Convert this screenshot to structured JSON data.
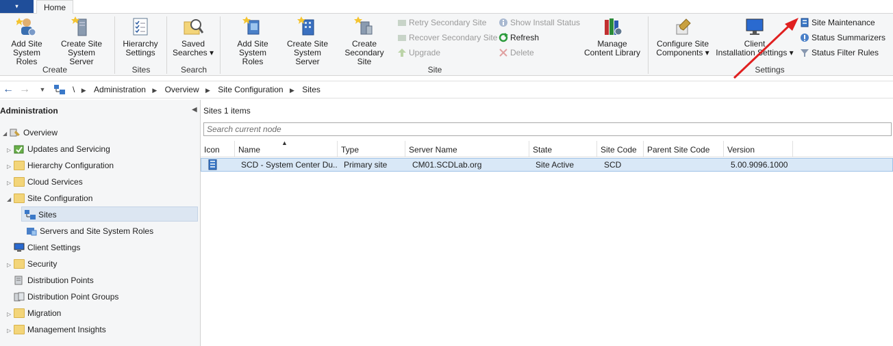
{
  "ribbon": {
    "tab_home": "Home",
    "groups": {
      "create": "Create",
      "sites": "Sites",
      "search": "Search",
      "site": "Site",
      "settings": "Settings"
    },
    "add_site_system_roles": [
      "Add Site",
      "System Roles"
    ],
    "create_site_system_server": [
      "Create Site",
      "System Server"
    ],
    "hierarchy_settings": [
      "Hierarchy",
      "Settings"
    ],
    "saved_searches": [
      "Saved",
      "Searches ▾"
    ],
    "add_site_system_roles_2": [
      "Add Site",
      "System Roles"
    ],
    "create_site_system_server_2": [
      "Create Site",
      "System Server"
    ],
    "create_secondary_site": [
      "Create",
      "Secondary Site"
    ],
    "retry_secondary_site": "Retry Secondary Site",
    "recover_secondary_site": "Recover Secondary Site",
    "upgrade": "Upgrade",
    "show_install_status": "Show Install Status",
    "refresh": "Refresh",
    "delete": "Delete",
    "manage_content_library": [
      "Manage",
      "Content Library"
    ],
    "configure_site_components": [
      "Configure Site",
      "Components ▾"
    ],
    "client_installation_settings": [
      "Client",
      "Installation Settings ▾"
    ],
    "site_maintenance": "Site Maintenance",
    "status_summarizers": "Status Summarizers",
    "status_filter_rules": "Status Filter Rules"
  },
  "address": {
    "root": "\\",
    "crumbs": [
      "Administration",
      "Overview",
      "Site Configuration",
      "Sites"
    ]
  },
  "left": {
    "title": "Administration",
    "tree": [
      {
        "label": "Overview"
      },
      {
        "label": "Updates and Servicing"
      },
      {
        "label": "Hierarchy Configuration"
      },
      {
        "label": "Cloud Services"
      },
      {
        "label": "Site Configuration"
      },
      {
        "label": "Sites"
      },
      {
        "label": "Servers and Site System Roles"
      },
      {
        "label": "Client Settings"
      },
      {
        "label": "Security"
      },
      {
        "label": "Distribution Points"
      },
      {
        "label": "Distribution Point Groups"
      },
      {
        "label": "Migration"
      },
      {
        "label": "Management Insights"
      }
    ]
  },
  "right": {
    "header": "Sites 1 items",
    "search_placeholder": "Search current node",
    "columns": [
      "Icon",
      "Name",
      "Type",
      "Server Name",
      "State",
      "Site Code",
      "Parent Site Code",
      "Version"
    ],
    "rows": [
      {
        "name": "SCD - System Center Du...",
        "type": "Primary site",
        "server": "CM01.SCDLab.org",
        "state": "Site Active",
        "site_code": "SCD",
        "parent_site_code": "",
        "version": "5.00.9096.1000"
      }
    ]
  },
  "colors": {
    "accent": "#1f4e9a",
    "selection": "#d9e8f7",
    "annotation_arrow": "#e02020"
  }
}
